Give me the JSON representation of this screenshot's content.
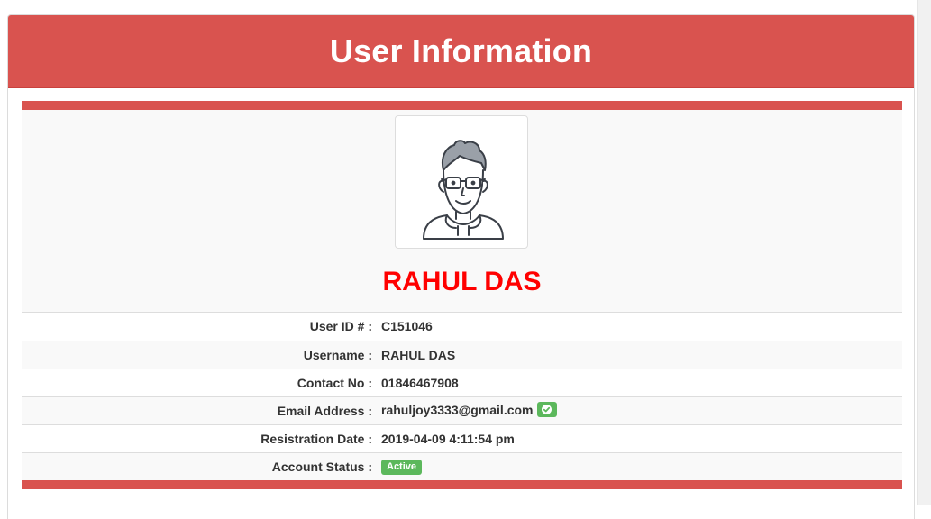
{
  "panel": {
    "title": "User Information"
  },
  "profile": {
    "avatar_icon": "user-avatar-glasses-icon",
    "name": "RAHUL DAS",
    "name_color": "#ff0000"
  },
  "details": [
    {
      "label": "User ID # :",
      "value": "C151046"
    },
    {
      "label": "Username :",
      "value": "RAHUL DAS"
    },
    {
      "label": "Contact No :",
      "value": "01846467908"
    },
    {
      "label": "Email Address :",
      "value": "rahuljoy3333@gmail.com",
      "verified_icon": "check-circle-icon"
    },
    {
      "label": "Resistration Date :",
      "value": "2019-04-09 4:11:54 pm"
    },
    {
      "label": "Account Status :",
      "status_badge": "Active"
    }
  ],
  "colors": {
    "accent": "#d9534f",
    "success": "#5cb85c"
  }
}
